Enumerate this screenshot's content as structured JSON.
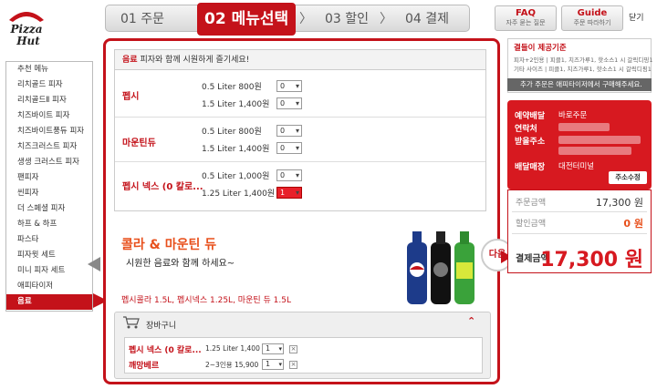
{
  "logo": {
    "text": "Pizza Hut"
  },
  "steps": [
    {
      "num": "01",
      "label": "주문"
    },
    {
      "num": "02",
      "label": "메뉴선택"
    },
    {
      "num": "03",
      "label": "할인"
    },
    {
      "num": "04",
      "label": "결제"
    }
  ],
  "top": {
    "faq_title": "FAQ",
    "faq_sub": "자주 묻는 질문",
    "guide_title": "Guide",
    "guide_sub": "주문 따라하기",
    "close": "닫기"
  },
  "menu": {
    "items": [
      "추천 메뉴",
      "리치골드 피자",
      "리치골드Ⅱ 피자",
      "치즈바이트 피자",
      "치즈바이트풍듀 피자",
      "치즈크러스트 피자",
      "생생 크러스트 피자",
      "팬피자",
      "씬피자",
      "더 스페셜 피자",
      "하프 & 하프",
      "파스타",
      "피자윗 세트",
      "미니 피자 세트",
      "애피타이저",
      "음료"
    ],
    "selected_index": 15
  },
  "drinks": {
    "header_highlight": "음료",
    "header_text": "피자와 함께 시원하게 즐기세요!",
    "groups": [
      {
        "name": "펩시",
        "options": [
          {
            "size": "0.5 Liter 800원",
            "qty": "0"
          },
          {
            "size": "1.5 Liter 1,400원",
            "qty": "0"
          }
        ]
      },
      {
        "name": "마운틴듀",
        "options": [
          {
            "size": "0.5 Liter 800원",
            "qty": "0"
          },
          {
            "size": "1.5 Liter 1,400원",
            "qty": "0"
          }
        ]
      },
      {
        "name": "펩시 넥스 (0 칼로...",
        "options": [
          {
            "size": "0.5 Liter 1,000원",
            "qty": "0"
          },
          {
            "size": "1.25 Liter 1,400원",
            "qty": "1"
          }
        ]
      }
    ]
  },
  "promo": {
    "title": "콜라 & 마운틴 듀",
    "subtitle": "시원한 음료와 함께 하세요~",
    "list": "펩시콜라 1.5L, 펩시넥스 1.25L, 마운틴 듀 1.5L",
    "next": "다음"
  },
  "cart": {
    "title": "장바구니",
    "items": [
      {
        "name": "펩시 넥스 (0 칼로...",
        "info": "1.25 Liter 1,400",
        "qty": "1",
        "del": "×"
      },
      {
        "name": "깨망베르",
        "info": "2~3인용 15,900",
        "qty": "1",
        "del": "×"
      }
    ]
  },
  "notice": {
    "title": "결들이 제공기준",
    "line1": "피자+2인용 | 피클1, 치즈가루1, 핫소스1 시 갈릭디핑1",
    "line2": "기타 사이즈 | 피클1, 치즈가루1, 핫소스1 시 갈릭디핑1",
    "bar": "추가 주문은 애피타이저에서 구매해주세요."
  },
  "order": {
    "type_label": "예약배달",
    "type_value": "바로주문",
    "contact_label": "연락처",
    "receiver_label": "받을주소",
    "store_label": "배달매장",
    "store_value": "대전터미널",
    "addr_btn": "주소수정"
  },
  "summary": {
    "order_label": "주문금액",
    "order_value": "17,300 원",
    "discount_label": "할인금액",
    "discount_value": "0 원",
    "total_label": "결제금액",
    "total_value": "17,300 원"
  },
  "colors": {
    "brand": "#c4121a",
    "accent": "#e8501c"
  }
}
